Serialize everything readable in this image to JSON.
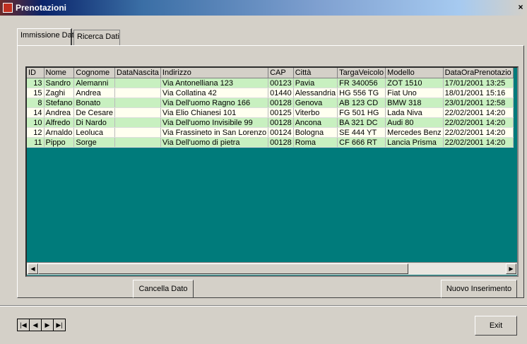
{
  "window": {
    "title": "Prenotazioni",
    "close_label": "×"
  },
  "tabs": [
    {
      "label": "Immissione Dati"
    },
    {
      "label": "Ricerca Dati"
    }
  ],
  "grid": {
    "columns": [
      "ID",
      "Nome",
      "Cognome",
      "DataNascita",
      "Indirizzo",
      "CAP",
      "Città",
      "TargaVeicolo",
      "Modello",
      "DataOraPrenotazio"
    ],
    "rows": [
      [
        "13",
        "Sandro",
        "Alemanni",
        "",
        "Via Antonelliana 123",
        "00123",
        "Pavia",
        "FR 340056",
        "ZOT 1510",
        "17/01/2001 13:25"
      ],
      [
        "15",
        "Zaghi",
        "Andrea",
        "",
        "Via Collatina 42",
        "01440",
        "Alessandria",
        "HG 556 TG",
        "Fiat Uno",
        "18/01/2001 15:16"
      ],
      [
        "8",
        "Stefano",
        "Bonato",
        "",
        "Via Dell'uomo Ragno 166",
        "00128",
        "Genova",
        "AB 123 CD",
        "BMW 318",
        "23/01/2001 12:58"
      ],
      [
        "14",
        "Andrea",
        "De Cesare",
        "",
        "Via Elio Chianesi 101",
        "00125",
        "Viterbo",
        "FG 501 HG",
        "Lada Niva",
        "22/02/2001 14:20"
      ],
      [
        "10",
        "Alfredo",
        "Di Nardo",
        "",
        "Via Dell'uomo Invisibile 99",
        "00128",
        "Ancona",
        "BA 321 DC",
        "Audi 80",
        "22/02/2001 14:20"
      ],
      [
        "12",
        "Arnaldo",
        "Leoluca",
        "",
        "Via Frassineto in San Lorenzo",
        "00124",
        "Bologna",
        "SE 444 YT",
        "Mercedes Benz",
        "22/02/2001 14:20"
      ],
      [
        "11",
        "Pippo",
        "Sorge",
        "",
        "Via Dell'uomo di pietra",
        "00128",
        "Roma",
        "CF 666 RT",
        "Lancia Prisma",
        "22/02/2001 14:20"
      ]
    ]
  },
  "scrollbar": {
    "left_arrow": "◀",
    "right_arrow": "▶"
  },
  "buttons": {
    "delete": "Cancella Dato",
    "new": "Nuovo Inserimento",
    "exit": "Exit"
  },
  "navigator": {
    "first": "|◀",
    "prev": "◀",
    "next": "▶",
    "last": "▶|"
  }
}
